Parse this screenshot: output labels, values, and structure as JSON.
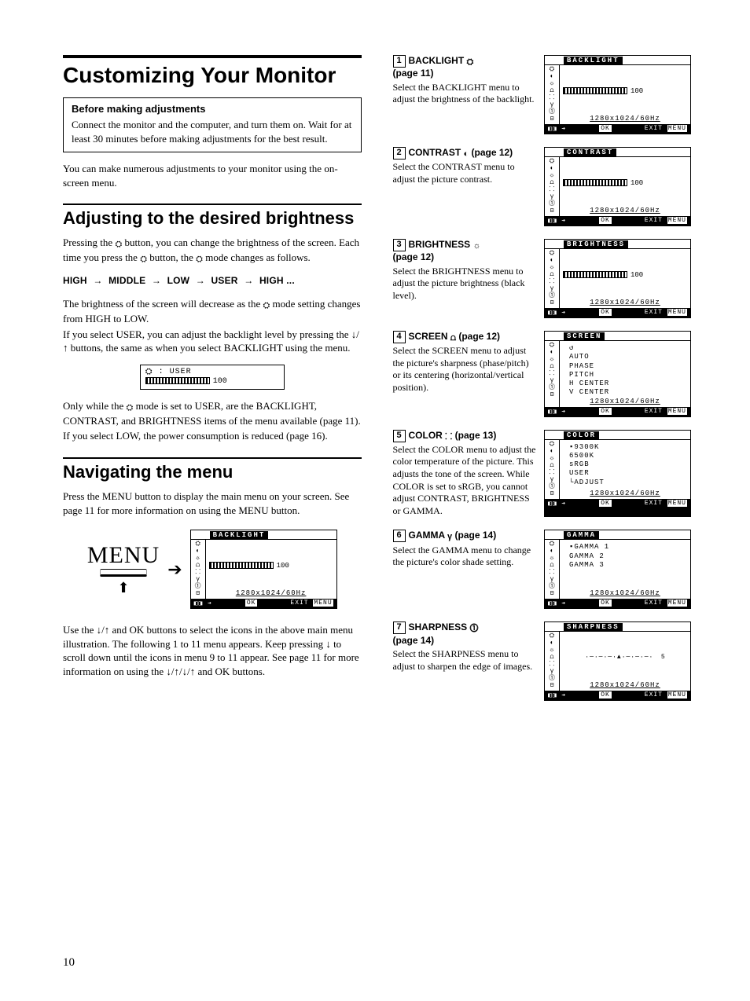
{
  "left": {
    "title": "Customizing Your Monitor",
    "before_heading": "Before making adjustments",
    "before_body": "Connect the monitor and the computer, and turn them on. Wait for at least 30 minutes before making adjustments for the best result.",
    "intro": "You can make numerous adjustments to your monitor using the on-screen menu.",
    "adj_heading": "Adjusting to the desired brightness",
    "adj_p1_a": "Pressing the ",
    "adj_p1_b": " button, you can change the brightness of the screen. Each time you press the ",
    "adj_p1_c": " button, the ",
    "adj_p1_d": " mode changes as follows.",
    "seq": [
      "HIGH",
      "MIDDLE",
      "LOW",
      "USER",
      "HIGH ..."
    ],
    "adj_p2_a": "The brightness of the screen will decrease as the ",
    "adj_p2_b": " mode setting changes from HIGH to LOW.",
    "adj_p3": "If you select USER, you can adjust the backlight level by pressing the ↓/↑ buttons, the same as when you select BACKLIGHT using the menu.",
    "userbox_label": ": USER",
    "userbox_value": "100",
    "adj_p4_a": "Only while the ",
    "adj_p4_b": " mode is set to USER, are the BACKLIGHT, CONTRAST, and BRIGHTNESS items of the menu available (page 11).",
    "adj_p5": "If you select LOW, the power consumption is reduced (page 16).",
    "nav_heading": "Navigating the menu",
    "nav_p1": "Press the MENU button to display the main menu on your screen. See page 11 for more information on using the MENU button.",
    "menu_word": "MENU",
    "nav_p2": "Use the ↓/↑ and OK buttons to select the icons in the above main menu illustration. The following 1 to 11 menu appears. Keep pressing ↓ to scroll down until the icons in menu 9 to 11 appear. See page 11 for more information on using the ↓/↑/↓/↑ and OK buttons."
  },
  "osd_common": {
    "resolution": "1280x1024/60Hz",
    "value100": "100",
    "foot_left": "◧◨ ➔",
    "foot_ok": "OK",
    "foot_exit": "EXIT",
    "foot_menu": "MENU"
  },
  "right": {
    "items": [
      {
        "num": "1",
        "title_a": "BACKLIGHT ",
        "title_b": "(page 11)",
        "desc": "Select the BACKLIGHT menu to adjust the brightness of the backlight.",
        "osd_title": "BACKLIGHT",
        "osd_type": "bar"
      },
      {
        "num": "2",
        "title_a": "CONTRAST ",
        "icon": "◐",
        "title_b": " (page 12)",
        "desc": "Select the CONTRAST menu to adjust the picture contrast.",
        "osd_title": "CONTRAST",
        "osd_type": "bar"
      },
      {
        "num": "3",
        "title_a": "BRIGHTNESS ",
        "icon": "☼",
        "title_b": "(page 12)",
        "desc": "Select the BRIGHTNESS menu to adjust the picture brightness (black level).",
        "osd_title": "BRIGHTNESS",
        "osd_type": "bar"
      },
      {
        "num": "4",
        "title_a": "SCREEN ",
        "icon": "⩍",
        "title_b": " (page 12)",
        "desc": "Select the SCREEN menu to adjust the picture's sharpness (phase/pitch) or its centering (horizontal/vertical position).",
        "osd_title": "SCREEN",
        "osd_type": "list",
        "osd_list": [
          "↺",
          "AUTO",
          "PHASE",
          "PITCH",
          "H CENTER",
          "V CENTER"
        ]
      },
      {
        "num": "5",
        "title_a": "COLOR ",
        "icon": "⸬",
        "title_b": " (page 13)",
        "desc": "Select the COLOR menu to adjust the color temperature of the picture. This adjusts the tone of the screen. While COLOR is set to sRGB, you cannot adjust CONTRAST, BRIGHTNESS or GAMMA.",
        "osd_title": "COLOR",
        "osd_type": "list",
        "osd_list": [
          "▪9300K",
          " 6500K",
          " sRGB",
          " USER",
          "  └ADJUST"
        ]
      },
      {
        "num": "6",
        "title_a": "GAMMA ",
        "icon": "γ",
        "title_b": " (page 14)",
        "desc": "Select the GAMMA menu to change the picture's color shade setting.",
        "osd_title": "GAMMA",
        "osd_type": "list",
        "osd_list": [
          "▪GAMMA 1",
          " GAMMA 2",
          " GAMMA 3"
        ]
      },
      {
        "num": "7",
        "title_a": "SHARPNESS ",
        "icon": "⓵",
        "title_b": "(page 14)",
        "desc": "Select the SHARPNESS menu to adjust to sharpen the edge of images.",
        "osd_title": "SHARPNESS",
        "osd_type": "slider",
        "osd_value": "5"
      }
    ]
  },
  "pagenum": "10"
}
